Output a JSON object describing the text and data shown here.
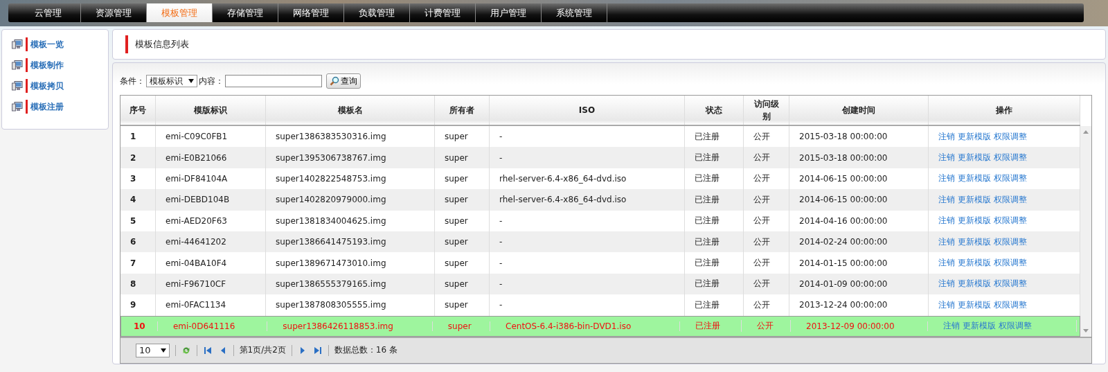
{
  "nav": {
    "tabs": [
      {
        "label": "云管理",
        "selected": false
      },
      {
        "label": "资源管理",
        "selected": false
      },
      {
        "label": "模板管理",
        "selected": true
      },
      {
        "label": "存储管理",
        "selected": false
      },
      {
        "label": "网络管理",
        "selected": false
      },
      {
        "label": "负载管理",
        "selected": false
      },
      {
        "label": "计费管理",
        "selected": false
      },
      {
        "label": "用户管理",
        "selected": false
      },
      {
        "label": "系统管理",
        "selected": false
      }
    ]
  },
  "sidebar": {
    "items": [
      "模板一览",
      "模板制作",
      "模板拷贝",
      "模板注册"
    ]
  },
  "panel_title": "模板信息列表",
  "search": {
    "condition_label": "条件：",
    "condition_value": "模板标识",
    "content_label": "内容：",
    "button": "查询"
  },
  "table": {
    "columns": [
      "序号",
      "模版标识",
      "模板名",
      "所有者",
      "ISO",
      "状态",
      "访问级别",
      "创建时间",
      "操作"
    ],
    "rows": [
      {
        "cells": [
          "1",
          "emi-C09C0FB1",
          "super1386383530316.img",
          "super",
          "-",
          "已注册",
          "公开",
          "2015-03-18 00:00:00"
        ],
        "actions": [
          "注销",
          "更新模版",
          "权限调整"
        ],
        "selected": false
      },
      {
        "cells": [
          "2",
          "emi-E0B21066",
          "super1395306738767.img",
          "super",
          "-",
          "已注册",
          "公开",
          "2015-03-18 00:00:00"
        ],
        "actions": [
          "注销",
          "更新模版",
          "权限调整"
        ],
        "selected": false
      },
      {
        "cells": [
          "3",
          "emi-DF84104A",
          "super1402822548753.img",
          "super",
          "rhel-server-6.4-x86_64-dvd.iso",
          "已注册",
          "公开",
          "2014-06-15 00:00:00"
        ],
        "actions": [
          "注销",
          "更新模版",
          "权限调整"
        ],
        "selected": false
      },
      {
        "cells": [
          "4",
          "emi-DEBD104B",
          "super1402820979000.img",
          "super",
          "rhel-server-6.4-x86_64-dvd.iso",
          "已注册",
          "公开",
          "2014-06-15 00:00:00"
        ],
        "actions": [
          "注销",
          "更新模版",
          "权限调整"
        ],
        "selected": false
      },
      {
        "cells": [
          "5",
          "emi-AED20F63",
          "super1381834004625.img",
          "super",
          "-",
          "已注册",
          "公开",
          "2014-04-16 00:00:00"
        ],
        "actions": [
          "注销",
          "更新模版",
          "权限调整"
        ],
        "selected": false
      },
      {
        "cells": [
          "6",
          "emi-44641202",
          "super1386641475193.img",
          "super",
          "-",
          "已注册",
          "公开",
          "2014-02-24 00:00:00"
        ],
        "actions": [
          "注销",
          "更新模版",
          "权限调整"
        ],
        "selected": false
      },
      {
        "cells": [
          "7",
          "emi-04BA10F4",
          "super1389671473010.img",
          "super",
          "-",
          "已注册",
          "公开",
          "2014-01-15 00:00:00"
        ],
        "actions": [
          "注销",
          "更新模版",
          "权限调整"
        ],
        "selected": false
      },
      {
        "cells": [
          "8",
          "emi-F96710CF",
          "super1386555379165.img",
          "super",
          "-",
          "已注册",
          "公开",
          "2014-01-09 00:00:00"
        ],
        "actions": [
          "注销",
          "更新模版",
          "权限调整"
        ],
        "selected": false
      },
      {
        "cells": [
          "9",
          "emi-0FAC1134",
          "super1387808305555.img",
          "super",
          "-",
          "已注册",
          "公开",
          "2013-12-24 00:00:00"
        ],
        "actions": [
          "注销",
          "更新模版",
          "权限调整"
        ],
        "selected": false
      },
      {
        "cells": [
          "10",
          "emi-0D641116",
          "super1386426118853.img",
          "super",
          "CentOS-6.4-i386-bin-DVD1.iso",
          "已注册",
          "公开",
          "2013-12-09 00:00:00"
        ],
        "actions": [
          "注销",
          "更新模版",
          "权限调整"
        ],
        "selected": true
      }
    ]
  },
  "pager": {
    "page_size": "10",
    "page_info": "第1页/共2页",
    "total": "数据总数：16 条"
  }
}
